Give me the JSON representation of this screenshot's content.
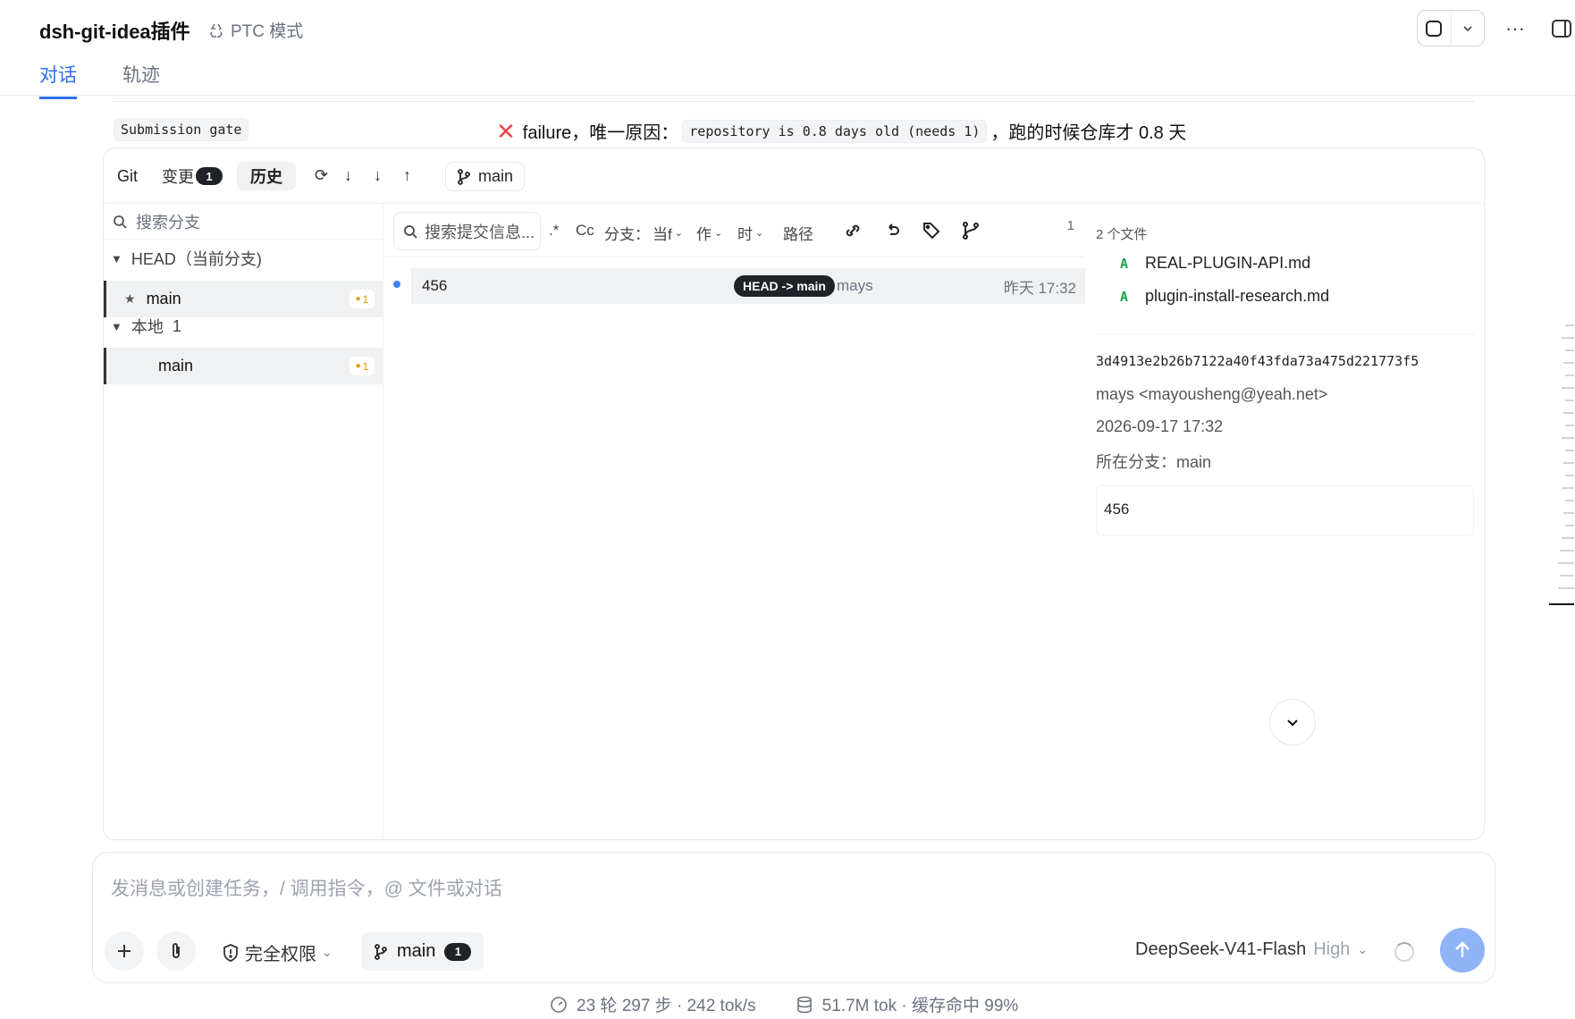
{
  "header": {
    "title": "dsh-git-idea插件",
    "mode": "PTC 模式",
    "tabs": [
      {
        "label": "对话",
        "active": true
      },
      {
        "label": "轨迹",
        "active": false
      }
    ]
  },
  "gate": {
    "label": "Submission gate",
    "status_text": "failure，唯一原因：",
    "reason_code": "repository is 0.8 days old (needs 1)",
    "suffix": "，跑的时候仓库才 0.8 天"
  },
  "git_toolbar": {
    "git_label": "Git",
    "changes_label": "变更",
    "changes_count": "1",
    "history_label": "历史",
    "branch": "main",
    "icons": [
      "refresh-icon",
      "pull-icon",
      "fetch-icon",
      "push-icon"
    ]
  },
  "sidebar": {
    "search_placeholder": "搜索分支",
    "head_group": "HEAD（当前分支)",
    "head_branch": "main",
    "head_badge": "1",
    "local_group": "本地",
    "local_count": "1",
    "local_branch": "main",
    "local_badge": "1"
  },
  "commit_list": {
    "search_placeholder": "搜索提交信息...",
    "regex_label": ".*",
    "case_label": "Cc",
    "branch_filter_label": "分支：",
    "branch_filter_value": "当f",
    "author_filter": "作",
    "time_filter": "时",
    "path_filter": "路径",
    "count": "1",
    "commits": [
      {
        "message": "456",
        "refs": "HEAD -> main",
        "author": "mays",
        "time": "昨天 17:32"
      }
    ]
  },
  "details": {
    "files_heading": "2 个文件",
    "files": [
      {
        "status": "A",
        "name": "REAL-PLUGIN-API.md"
      },
      {
        "status": "A",
        "name": "plugin-install-research.md"
      }
    ],
    "hash": "3d4913e2b26b7122a40f43fda73a475d221773f5",
    "author": "mays <mayousheng@yeah.net>",
    "date": "2026-09-17 17:32",
    "branch_line": "所在分支：main",
    "message": "456"
  },
  "composer": {
    "placeholder": "发消息或创建任务，/ 调用指令，@ 文件或对话",
    "permission": "完全权限",
    "branch": "main",
    "branch_count": "1",
    "model": "DeepSeek-V41-Flash",
    "effort": "High"
  },
  "status_bar": {
    "progress": "23 轮 297 步 · 242 tok/s",
    "tokens": "51.7M tok · 缓存命中 99%"
  },
  "colors": {
    "accent": "#2f6feb",
    "added": "#16a34a",
    "error": "#e5484d",
    "badge_orange": "#e69500",
    "send_button": "#8fb3f7"
  }
}
